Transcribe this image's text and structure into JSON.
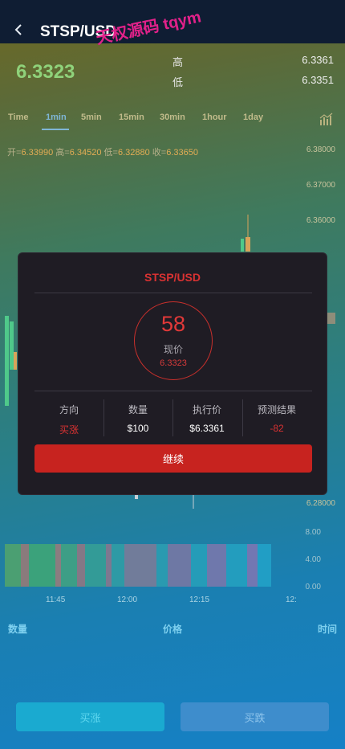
{
  "header": {
    "back_icon": "chevron-left-icon",
    "title": "STSP/USD",
    "watermark": "天权源码 tqym"
  },
  "quote": {
    "current_price": "6.3323",
    "high_label": "高",
    "high_value": "6.3361",
    "low_label": "低",
    "low_value": "6.3351"
  },
  "timeframes": [
    "Time",
    "1min",
    "5min",
    "15min",
    "30min",
    "1hour",
    "1day"
  ],
  "active_timeframe": "1min",
  "ohlc": {
    "open_label": "开=",
    "open": "6.33990",
    "high_label": "高=",
    "high": "6.34520",
    "low_label": "低=",
    "low": "6.32880",
    "close_label": "收=",
    "close": "6.33650"
  },
  "price_axis": [
    "6.38000",
    "6.37000",
    "6.36000",
    "6.28000"
  ],
  "volume_axis": [
    "8.00",
    "4.00",
    "0.00"
  ],
  "time_axis": [
    "11:45",
    "12:00",
    "12:15",
    "12:"
  ],
  "footer_labels": {
    "quantity": "数量",
    "price": "价格",
    "time": "时间"
  },
  "actions": {
    "buy_up": "买涨",
    "buy_down": "买跌"
  },
  "modal": {
    "title": "STSP/USD",
    "countdown": "58",
    "current_price_label": "现价",
    "current_price": "6.3323",
    "columns": [
      {
        "label": "方向",
        "value": "买涨"
      },
      {
        "label": "数量",
        "value": "$100"
      },
      {
        "label": "执行价",
        "value": "$6.3361"
      },
      {
        "label": "预测结果",
        "value": "-82"
      }
    ],
    "continue_label": "继续"
  },
  "colors": {
    "up": "#4fc98a",
    "down": "#d93232",
    "accent": "#7fb6d6"
  }
}
